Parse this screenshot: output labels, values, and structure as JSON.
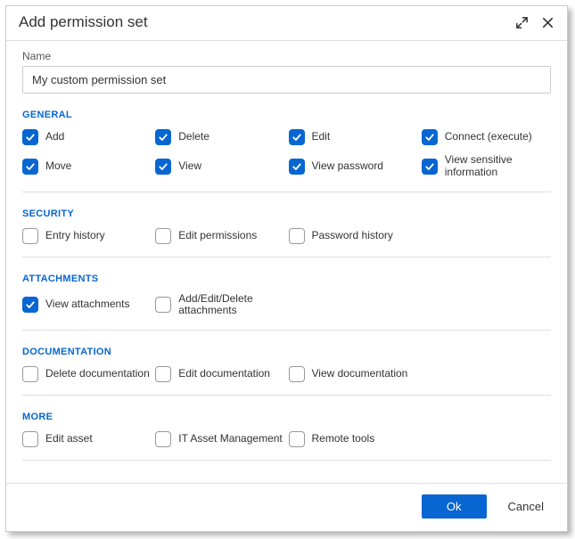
{
  "dialog": {
    "title": "Add permission set",
    "name_label": "Name",
    "name_value": "My custom permission set"
  },
  "sections": [
    {
      "title": "GENERAL",
      "key": "general",
      "options": [
        {
          "label": "Add",
          "checked": true
        },
        {
          "label": "Delete",
          "checked": true
        },
        {
          "label": "Edit",
          "checked": true
        },
        {
          "label": "Connect (execute)",
          "checked": true
        },
        {
          "label": "Move",
          "checked": true
        },
        {
          "label": "View",
          "checked": true
        },
        {
          "label": "View password",
          "checked": true
        },
        {
          "label": "View sensitive information",
          "checked": true
        }
      ]
    },
    {
      "title": "SECURITY",
      "key": "security",
      "options": [
        {
          "label": "Entry history",
          "checked": false
        },
        {
          "label": "Edit permissions",
          "checked": false
        },
        {
          "label": "Password history",
          "checked": false
        }
      ]
    },
    {
      "title": "ATTACHMENTS",
      "key": "attachments",
      "options": [
        {
          "label": "View attachments",
          "checked": true
        },
        {
          "label": "Add/Edit/Delete attachments",
          "checked": false
        }
      ]
    },
    {
      "title": "DOCUMENTATION",
      "key": "documentation",
      "options": [
        {
          "label": "Delete documentation",
          "checked": false
        },
        {
          "label": "Edit documentation",
          "checked": false
        },
        {
          "label": "View documentation",
          "checked": false
        }
      ]
    },
    {
      "title": "MORE",
      "key": "more",
      "options": [
        {
          "label": "Edit asset",
          "checked": false
        },
        {
          "label": "IT Asset Management",
          "checked": false
        },
        {
          "label": "Remote tools",
          "checked": false
        }
      ]
    }
  ],
  "footer": {
    "ok_label": "Ok",
    "cancel_label": "Cancel"
  }
}
